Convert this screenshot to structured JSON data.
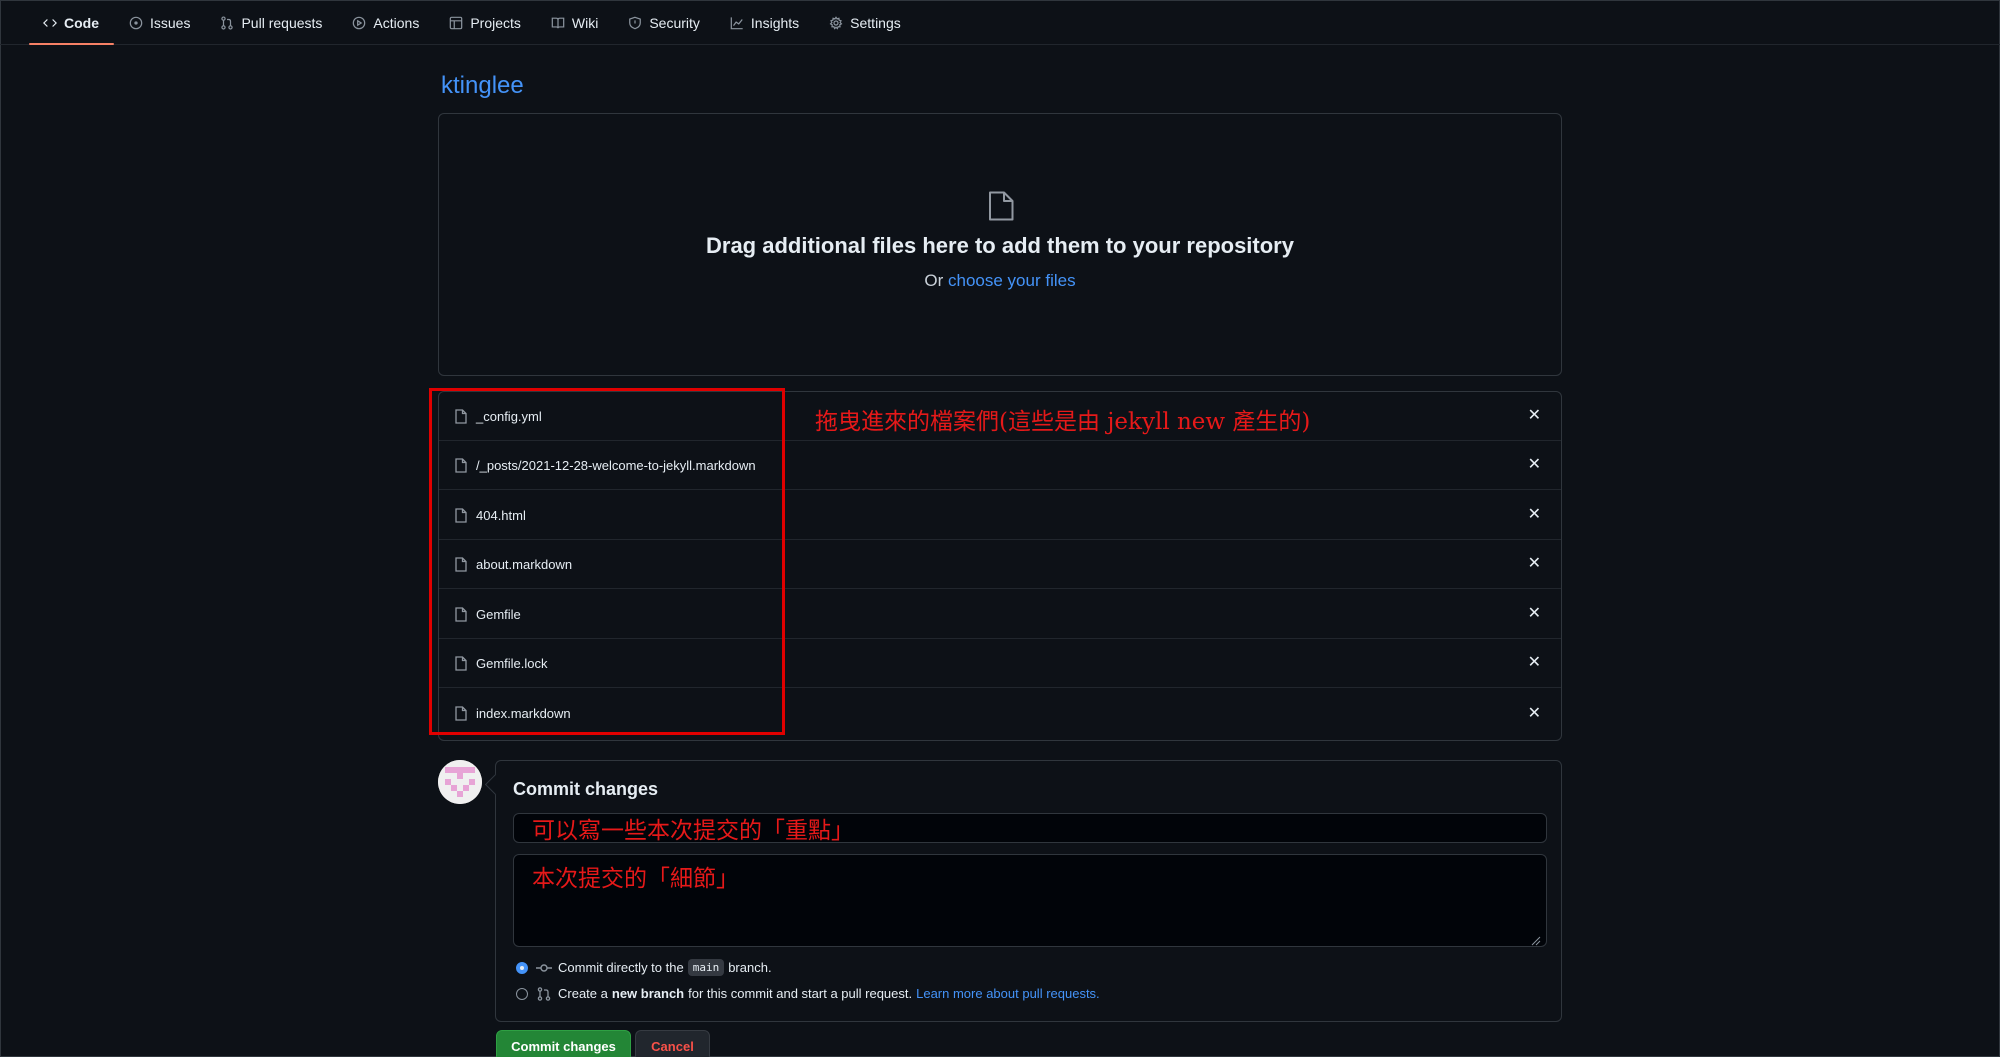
{
  "nav": {
    "tabs": [
      {
        "label": "Code",
        "icon": "code-icon"
      },
      {
        "label": "Issues",
        "icon": "issue-icon"
      },
      {
        "label": "Pull requests",
        "icon": "pull-request-icon"
      },
      {
        "label": "Actions",
        "icon": "play-icon"
      },
      {
        "label": "Projects",
        "icon": "table-icon"
      },
      {
        "label": "Wiki",
        "icon": "book-icon"
      },
      {
        "label": "Security",
        "icon": "shield-icon"
      },
      {
        "label": "Insights",
        "icon": "graph-icon"
      },
      {
        "label": "Settings",
        "icon": "gear-icon"
      }
    ],
    "active_tab": "Code"
  },
  "repo": {
    "name": "ktinglee"
  },
  "dropzone": {
    "title": "Drag additional files here to add them to your repository",
    "sub_prefix": "Or",
    "sub_link": "choose your files"
  },
  "files": [
    {
      "name": "_config.yml"
    },
    {
      "name": "/_posts/2021-12-28-welcome-to-jekyll.markdown"
    },
    {
      "name": "404.html"
    },
    {
      "name": "about.markdown"
    },
    {
      "name": "Gemfile"
    },
    {
      "name": "Gemfile.lock"
    },
    {
      "name": "index.markdown"
    }
  ],
  "remove_glyph": "✕",
  "annotation": {
    "files_note": "拖曳進來的檔案們(這些是由 jekyll new 產生的)",
    "color": "#e61919"
  },
  "commit": {
    "title": "Commit changes",
    "summary_value": "可以寫一些本次提交的「重點」",
    "description_value": "本次提交的「細節」",
    "option_direct_prefix": "Commit directly to the",
    "option_direct_branch": "main",
    "option_direct_suffix": "branch.",
    "option_new_prefix": "Create a",
    "option_new_bold": "new branch",
    "option_new_suffix": "for this commit and start a pull request.",
    "option_new_link": "Learn more about pull requests.",
    "selected_option": "direct",
    "commit_button": "Commit changes",
    "cancel_button": "Cancel"
  },
  "colors": {
    "background": "#0d1117",
    "link": "#4493f8",
    "commit_green": "#238636",
    "cancel_red": "#f85149",
    "active_tab_underline": "#f78166"
  }
}
